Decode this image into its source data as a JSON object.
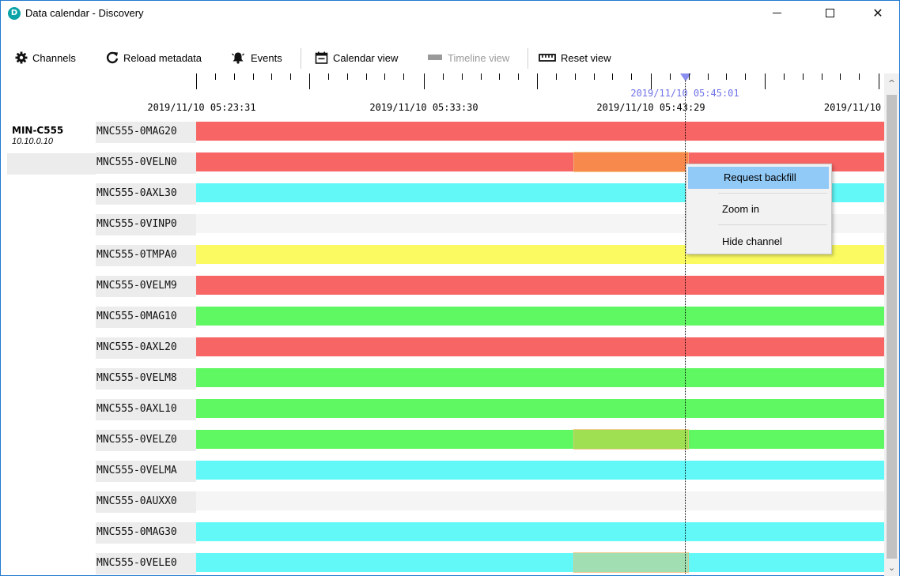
{
  "window": {
    "title": "Data calendar - Discovery",
    "app_icon": "D",
    "minimize_icon": "minimize-icon",
    "maximize_icon": "maximize-icon",
    "close_glyph": "✕"
  },
  "toolbar": {
    "channels_label": "Channels",
    "reload_label": "Reload metadata",
    "events_label": "Events",
    "calendar_label": "Calendar view",
    "timeline_label": "Timeline view",
    "reset_label": "Reset view",
    "icons": [
      "gear-icon",
      "reload-icon",
      "bell-icon",
      "calendar-icon",
      "timeline-icon",
      "ruler-icon"
    ]
  },
  "timeline": {
    "labels": [
      "2019/11/10 05:23:31",
      "2019/11/10 05:33:30",
      "2019/11/10 05:43:29",
      "2019/11/10"
    ],
    "cursor_time": "2019/11/10 05:45:01",
    "cursor_color": "#6f73e8"
  },
  "station": {
    "name": "MIN-C555",
    "ip": "10.10.0.10"
  },
  "colors": {
    "red": "#f76565",
    "cyan": "#62f8f8",
    "empty": "#f5f5f5",
    "yellow": "#fbfb61",
    "green": "#60f862",
    "gap_orange": "#f8894d",
    "gap_olive": "#9fe052",
    "gap_mint": "#a1dfb3"
  },
  "channels": [
    {
      "name": "MNC555-0MAG20",
      "color": "red"
    },
    {
      "name": "MNC555-0VELN0",
      "color": "red",
      "gap": "gap_orange"
    },
    {
      "name": "MNC555-0AXL30",
      "color": "cyan"
    },
    {
      "name": "MNC555-0VINP0",
      "color": "empty"
    },
    {
      "name": "MNC555-0TMPA0",
      "color": "yellow"
    },
    {
      "name": "MNC555-0VELM9",
      "color": "red"
    },
    {
      "name": "MNC555-0MAG10",
      "color": "green"
    },
    {
      "name": "MNC555-0AXL20",
      "color": "red"
    },
    {
      "name": "MNC555-0VELM8",
      "color": "green"
    },
    {
      "name": "MNC555-0AXL10",
      "color": "green"
    },
    {
      "name": "MNC555-0VELZ0",
      "color": "green",
      "gap": "gap_olive"
    },
    {
      "name": "MNC555-0VELMA",
      "color": "cyan"
    },
    {
      "name": "MNC555-0AUXX0",
      "color": "empty"
    },
    {
      "name": "MNC555-0MAG30",
      "color": "cyan"
    },
    {
      "name": "MNC555-0VELE0",
      "color": "cyan",
      "gap": "gap_mint"
    }
  ],
  "context_menu": {
    "request_backfill": "Request backfill",
    "zoom_in": "Zoom in",
    "hide_channel": "Hide channel"
  },
  "scrollbar": {
    "up_glyph": "^",
    "down_glyph": "⌄"
  }
}
